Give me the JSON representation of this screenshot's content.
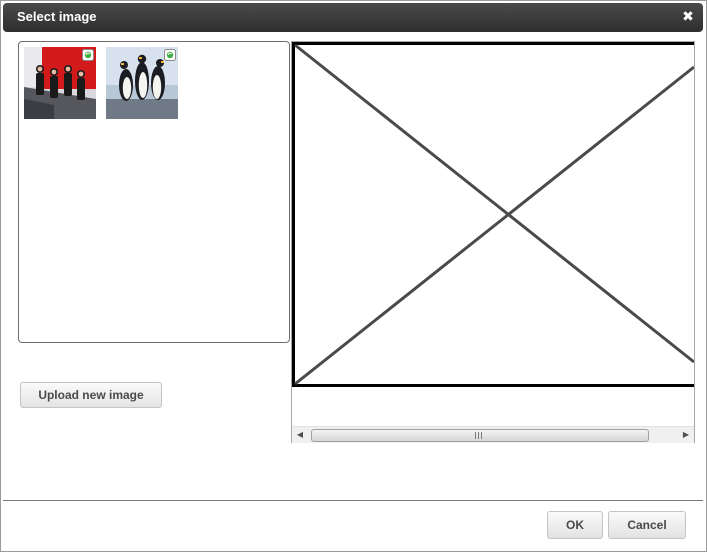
{
  "dialog": {
    "title": "Select image",
    "close_icon": "close-icon"
  },
  "gallery": {
    "items": [
      {
        "name": "band-photo",
        "badge_icon": "refresh-icon"
      },
      {
        "name": "penguins-photo",
        "badge_icon": "refresh-icon"
      }
    ]
  },
  "upload": {
    "label": "Upload new image"
  },
  "preview": {
    "placeholder_icon": "image-placeholder-icon",
    "scroll_left_icon": "scroll-left-arrow",
    "scroll_right_icon": "scroll-right-arrow",
    "grip_icon": "scroll-grip-icon"
  },
  "footer": {
    "ok_label": "OK",
    "cancel_label": "Cancel"
  },
  "colors": {
    "titlebar": "#3a3a3a",
    "title_text": "#ffffff",
    "placeholder_stroke": "#4a4a4a",
    "placeholder_border": "#000000"
  }
}
